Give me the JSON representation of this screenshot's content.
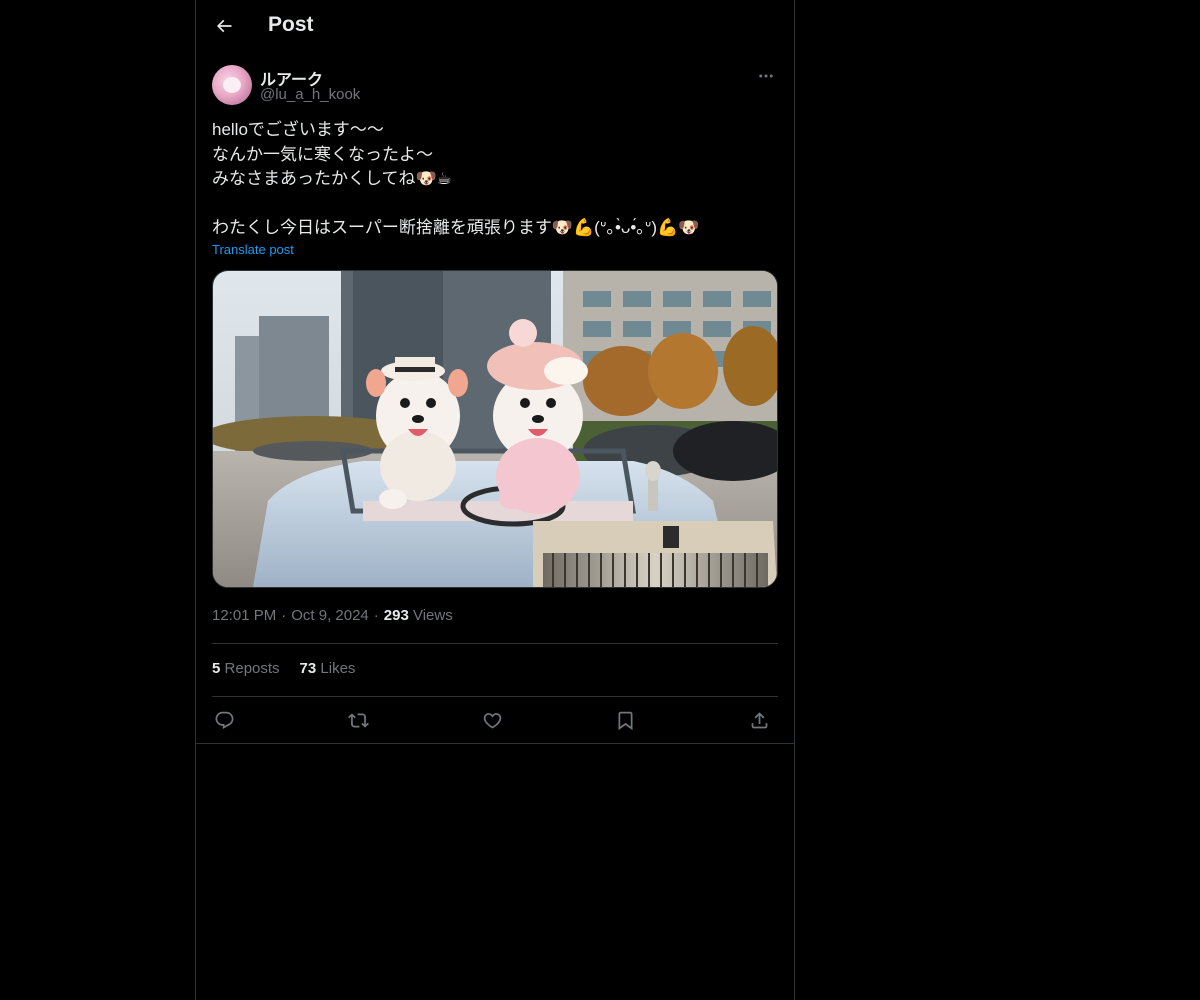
{
  "header": {
    "title": "Post",
    "back_icon": "arrow-left-icon"
  },
  "author": {
    "display_name": "ルアーク",
    "handle": "@lu_a_h_kook",
    "more_icon": "more-horizontal-icon"
  },
  "post": {
    "lines": [
      "helloでございます〜〜",
      "なんか一気に寒くなったよ〜",
      "みなさまあったかくしてね🐶☕",
      "わたくし今日はスーパー断捨離を頑張ります🐶💪(ᐡ｡•̀ᴗ•́｡ᐡ)💪🐶"
    ],
    "translate_label": "Translate post",
    "image_description_icon": "media-photo"
  },
  "meta": {
    "time": "12:01 PM",
    "date": "Oct 9, 2024",
    "views_count": "293",
    "views_label": "Views"
  },
  "stats": {
    "reposts_count": "5",
    "reposts_label": "Reposts",
    "likes_count": "73",
    "likes_label": "Likes"
  },
  "actions": {
    "reply_icon": "reply-icon",
    "repost_icon": "repost-icon",
    "like_icon": "heart-icon",
    "bookmark_icon": "bookmark-icon",
    "share_icon": "share-icon"
  },
  "colors": {
    "background": "#000000",
    "text": "#e7e9ea",
    "secondary": "#71767b",
    "accent": "#1d9bf0",
    "border": "#2f3336"
  }
}
